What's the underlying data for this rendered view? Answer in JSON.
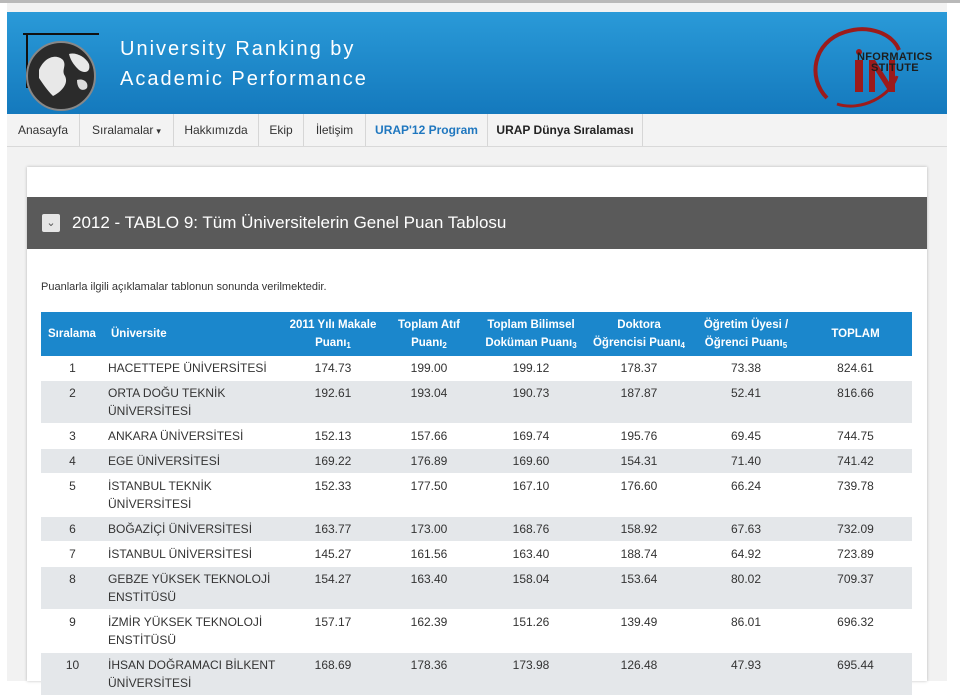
{
  "header": {
    "title_line1": "University Ranking by",
    "title_line2": "Academic Performance",
    "institute_line1": "NFORMATICS",
    "institute_line2": "STITUTE"
  },
  "nav": {
    "items": [
      "Anasayfa",
      "Sıralamalar",
      "Hakkımızda",
      "Ekip",
      "İletişim",
      "URAP'12 Program",
      "URAP Dünya Sıralaması"
    ],
    "caret": "▾"
  },
  "panel": {
    "toggle": "⌄",
    "title": "2012 - TABLO 9: Tüm Üniversitelerin Genel Puan Tablosu",
    "note": "Puanlarla ilgili açıklamalar tablonun sonunda verilmektedir."
  },
  "table": {
    "headers": [
      {
        "text": "Sıralama"
      },
      {
        "text": "Üniversite"
      },
      {
        "line1": "2011 Yılı Makale",
        "line2": "Puanı",
        "sup": "1"
      },
      {
        "line1": "Toplam Atıf",
        "line2": "Puanı",
        "sup": "2"
      },
      {
        "line1": "Toplam Bilimsel",
        "line2": "Doküman Puanı",
        "sup": "3"
      },
      {
        "line1": "Doktora",
        "line2": "Öğrencisi Puanı",
        "sup": "4"
      },
      {
        "line1": "Öğretim Üyesi /",
        "line2": "Öğrenci Puanı",
        "sup": "5"
      },
      {
        "text": "TOPLAM"
      }
    ],
    "rows": [
      {
        "rank": "1",
        "name": [
          "HACETTEPE ÜNİVERSİTESİ"
        ],
        "makale": "174.73",
        "atif": "199.00",
        "dokuman": "199.12",
        "doktora": "178.37",
        "ogretim": "73.38",
        "toplam": "824.61"
      },
      {
        "rank": "2",
        "name": [
          "ORTA DOĞU TEKNİK",
          "ÜNİVERSİTESİ"
        ],
        "makale": "192.61",
        "atif": "193.04",
        "dokuman": "190.73",
        "doktora": "187.87",
        "ogretim": "52.41",
        "toplam": "816.66"
      },
      {
        "rank": "3",
        "name": [
          "ANKARA ÜNİVERSİTESİ"
        ],
        "makale": "152.13",
        "atif": "157.66",
        "dokuman": "169.74",
        "doktora": "195.76",
        "ogretim": "69.45",
        "toplam": "744.75"
      },
      {
        "rank": "4",
        "name": [
          "EGE ÜNİVERSİTESİ"
        ],
        "makale": "169.22",
        "atif": "176.89",
        "dokuman": "169.60",
        "doktora": "154.31",
        "ogretim": "71.40",
        "toplam": "741.42"
      },
      {
        "rank": "5",
        "name": [
          "İSTANBUL TEKNİK",
          "ÜNİVERSİTESİ"
        ],
        "makale": "152.33",
        "atif": "177.50",
        "dokuman": "167.10",
        "doktora": "176.60",
        "ogretim": "66.24",
        "toplam": "739.78"
      },
      {
        "rank": "6",
        "name": [
          "BOĞAZİÇİ ÜNİVERSİTESİ"
        ],
        "makale": "163.77",
        "atif": "173.00",
        "dokuman": "168.76",
        "doktora": "158.92",
        "ogretim": "67.63",
        "toplam": "732.09"
      },
      {
        "rank": "7",
        "name": [
          "İSTANBUL ÜNİVERSİTESİ"
        ],
        "makale": "145.27",
        "atif": "161.56",
        "dokuman": "163.40",
        "doktora": "188.74",
        "ogretim": "64.92",
        "toplam": "723.89"
      },
      {
        "rank": "8",
        "name": [
          "GEBZE YÜKSEK TEKNOLOJİ",
          "ENSTİTÜSÜ"
        ],
        "makale": "154.27",
        "atif": "163.40",
        "dokuman": "158.04",
        "doktora": "153.64",
        "ogretim": "80.02",
        "toplam": "709.37"
      },
      {
        "rank": "9",
        "name": [
          "İZMİR YÜKSEK TEKNOLOJİ",
          "ENSTİTÜSÜ"
        ],
        "makale": "157.17",
        "atif": "162.39",
        "dokuman": "151.26",
        "doktora": "139.49",
        "ogretim": "86.01",
        "toplam": "696.32"
      },
      {
        "rank": "10",
        "name": [
          "İHSAN DOĞRAMACI BİLKENT",
          "ÜNİVERSİTESİ"
        ],
        "makale": "168.69",
        "atif": "178.36",
        "dokuman": "173.98",
        "doktora": "126.48",
        "ogretim": "47.93",
        "toplam": "695.44"
      }
    ]
  }
}
